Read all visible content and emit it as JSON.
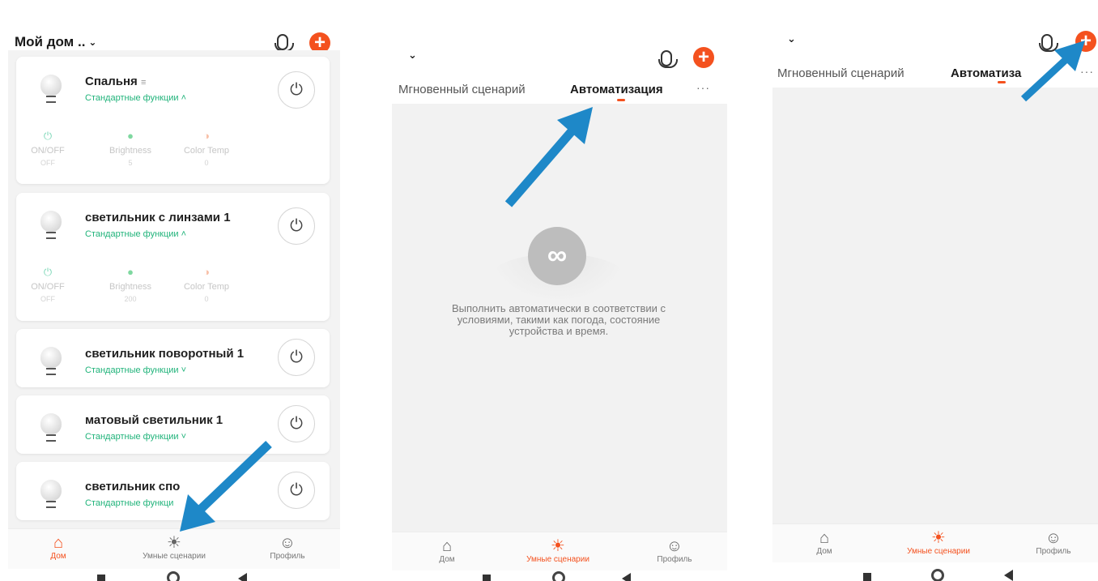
{
  "screen1": {
    "home_title": "Мой дом ..",
    "devices": [
      {
        "name": "Спальня",
        "name_suffix": "≡",
        "func": "Стандартные функции ˄",
        "expanded": true,
        "controls": [
          {
            "icon": "⏻",
            "label": "ON/OFF",
            "value": "OFF",
            "color": "#7fd8b9"
          },
          {
            "icon": "●",
            "label": "Brightness",
            "value": "5",
            "color": "#7fd8a0"
          },
          {
            "icon": "◑",
            "label": "Color Temp",
            "value": "0",
            "color": "#f8c0a8"
          }
        ]
      },
      {
        "name": "светильник с линзами 1",
        "name_suffix": "",
        "func": "Стандартные функции ˄",
        "expanded": true,
        "controls": [
          {
            "icon": "⏻",
            "label": "ON/OFF",
            "value": "OFF",
            "color": "#7fd8b9"
          },
          {
            "icon": "●",
            "label": "Brightness",
            "value": "200",
            "color": "#7fd8a0"
          },
          {
            "icon": "◑",
            "label": "Color Temp",
            "value": "0",
            "color": "#f8c0a8"
          }
        ]
      },
      {
        "name": "светильник поворотный 1",
        "name_suffix": "",
        "func": "Стандартные функции ˅",
        "expanded": false
      },
      {
        "name": "матовый светильник 1",
        "name_suffix": "",
        "func": "Стандартные функции ˅",
        "expanded": false
      },
      {
        "name": "светильник спо",
        "name_suffix": "",
        "func": "Стандартные функци",
        "expanded": false
      }
    ],
    "tabbar": [
      {
        "label": "Дом",
        "icon": "home-icon",
        "active": true
      },
      {
        "label": "Умные сценарии",
        "icon": "sun-icon",
        "active": false
      },
      {
        "label": "Профиль",
        "icon": "profile-icon",
        "active": false
      }
    ]
  },
  "screen2": {
    "tab_instant": "Мгновенный сценарий",
    "tab_auto": "Автоматизация",
    "more": "···",
    "empty_text": "Выполнить автоматически в соответствии с условиями, такими как погода, состояние устройства и время.",
    "tabbar": [
      {
        "label": "Дом",
        "icon": "home-icon",
        "active": false
      },
      {
        "label": "Умные сценарии",
        "icon": "sun-icon",
        "active": true
      },
      {
        "label": "Профиль",
        "icon": "profile-icon",
        "active": false
      }
    ]
  },
  "screen3": {
    "tab_instant": "Мгновенный сценарий",
    "tab_auto": "Автоматиза",
    "more": "···",
    "tabbar": [
      {
        "label": "Дом",
        "icon": "home-icon",
        "active": false
      },
      {
        "label": "Умные сценарии",
        "icon": "sun-icon",
        "active": true
      },
      {
        "label": "Профиль",
        "icon": "profile-icon",
        "active": false
      }
    ]
  },
  "icons": {
    "power": "⏻",
    "plus": "+",
    "chevron_down": "ˇ",
    "loop": "∞",
    "home": "⌂",
    "sun": "☀",
    "profile": "☺"
  },
  "colors": {
    "accent": "#f4511e",
    "func_green": "#20b37a",
    "arrow_blue": "#1e88c8",
    "panel_gray": "#f2f2f2"
  }
}
